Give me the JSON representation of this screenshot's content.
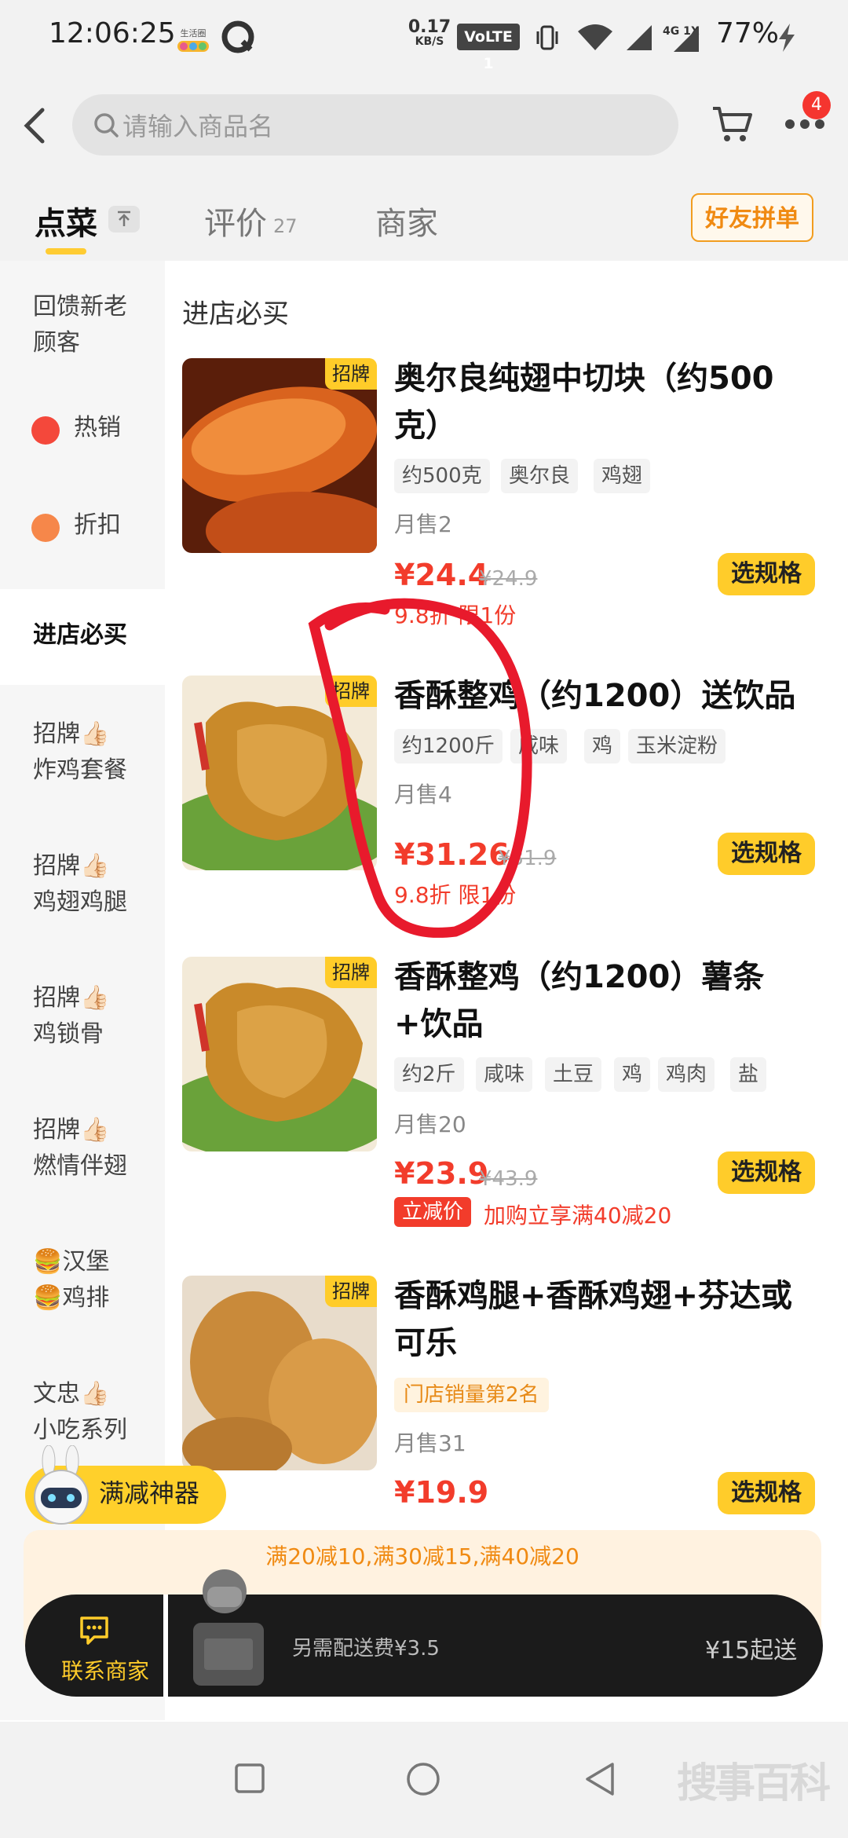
{
  "status_bar": {
    "time": "12:06:25",
    "speed_value": "0.17",
    "speed_unit": "KB/S",
    "volte": "VoLTE 1",
    "network": "4G 1X",
    "battery": "77%",
    "app_icon_text": "生活圈"
  },
  "header": {
    "search_placeholder": "请输入商品名",
    "more_badge": "4"
  },
  "tabs": {
    "order": "点菜",
    "reviews": "评价",
    "reviews_count": "27",
    "merchant": "商家",
    "friend_button": "好友拼单"
  },
  "sidebar": {
    "items": [
      {
        "label_1": "回馈新老",
        "label_2": "顾客"
      },
      {
        "label": "热销"
      },
      {
        "label": "折扣"
      },
      {
        "label": "进店必买"
      },
      {
        "label_1": "招牌👍🏻",
        "label_2": "炸鸡套餐"
      },
      {
        "label_1": "招牌👍🏻",
        "label_2": "鸡翅鸡腿"
      },
      {
        "label_1": "招牌👍🏻",
        "label_2": "鸡锁骨"
      },
      {
        "label_1": "招牌👍🏻",
        "label_2": "燃情伴翅"
      },
      {
        "label_1": "🍔汉堡",
        "label_2": "🍔鸡排"
      },
      {
        "label_1": "文忠👍🏻",
        "label_2": "小吃系列"
      }
    ]
  },
  "section_title": "进店必买",
  "signature_label": "招牌",
  "spec_button_label": "选规格",
  "products": [
    {
      "title": "奥尔良纯翅中切块（约500克）",
      "tags": [
        "约500克",
        "奥尔良",
        "鸡翅"
      ],
      "sold": "月售2",
      "price": "¥24.4",
      "old_price": "¥24.9",
      "promo": "9.8折 限1份"
    },
    {
      "title": "香酥整鸡（约1200）送饮品",
      "tags": [
        "约1200斤",
        "咸味",
        "鸡",
        "玉米淀粉"
      ],
      "sold": "月售4",
      "price": "¥31.26",
      "old_price": "¥31.9",
      "promo": "9.8折 限1份"
    },
    {
      "title": "香酥整鸡（约1200）薯条+饮品",
      "tags": [
        "约2斤",
        "咸味",
        "土豆",
        "鸡",
        "鸡肉",
        "盐"
      ],
      "sold": "月售20",
      "price": "¥23.9",
      "old_price": "¥43.9",
      "instant_badge": "立减价",
      "promo": "加购立享满40减20"
    },
    {
      "title": "香酥鸡腿+香酥鸡翅+芬达或可乐",
      "rank_tag": "门店销量第2名",
      "sold": "月售31",
      "price": "¥19.9"
    }
  ],
  "floating": {
    "discount_label": "满减神器",
    "promo_banner": "满20减10,满30减15,满40减20",
    "contact_label": "联系商家",
    "delivery_fee": "另需配送费¥3.5",
    "min_order": "¥15起送"
  },
  "watermark": "搜事百科",
  "colors": {
    "accent_yellow": "#ffcc2a",
    "price_red": "#f23c2b",
    "orange": "#f08a12"
  }
}
